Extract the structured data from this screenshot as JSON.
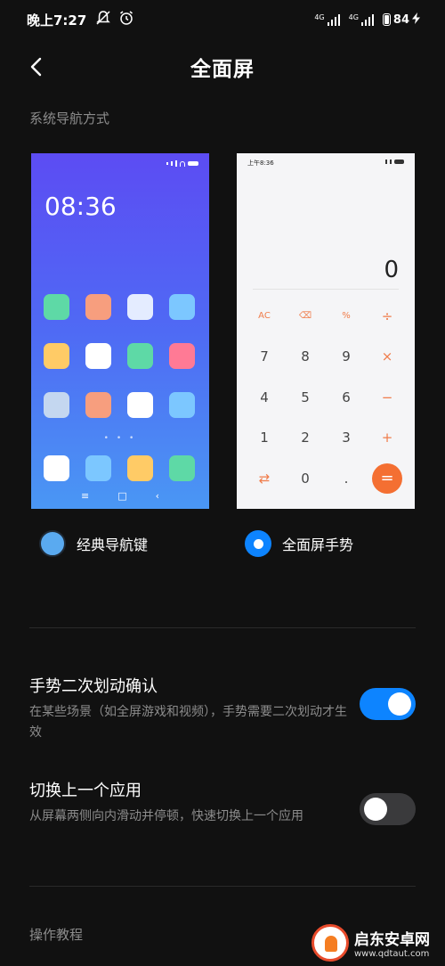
{
  "status_bar": {
    "time": "晚上7:27",
    "left_icons": [
      "notification-muted-icon",
      "alarm-icon"
    ],
    "network_1": "4G",
    "network_2": "4G",
    "battery": "84"
  },
  "header": {
    "title": "全面屏",
    "back_icon": "chevron-left-icon"
  },
  "nav_section": {
    "title": "系统导航方式"
  },
  "classic_preview": {
    "clock": "08:36",
    "app_colors": [
      "#5ed9a6",
      "#f79e7e",
      "#e4ecff",
      "#7cc7ff",
      "#ffcb66",
      "#ffffff",
      "#5ed9a6",
      "#ff7a95",
      "#c4d7f0",
      "#f79e7e",
      "#ffffff",
      "#7cc7ff"
    ],
    "dock_colors": [
      "#ffffff",
      "#7cc7ff",
      "#ffcb66",
      "#5ed9a6"
    ],
    "page_dots": "• • •",
    "nav_keys": [
      "≡",
      "□",
      "‹"
    ]
  },
  "gesture_preview": {
    "time": "上午8:36",
    "display": "0",
    "keys": [
      "AC",
      "⌫",
      "%",
      "÷",
      "7",
      "8",
      "9",
      "×",
      "4",
      "5",
      "6",
      "−",
      "1",
      "2",
      "3",
      "+",
      "⇄",
      "0",
      ".",
      "="
    ]
  },
  "options": [
    {
      "label": "经典导航键",
      "selected": false
    },
    {
      "label": "全面屏手势",
      "selected": true
    }
  ],
  "settings": [
    {
      "title": "手势二次划动确认",
      "desc": "在某些场景（如全屏游戏和视频），手势需要二次划动才生效",
      "enabled": true
    },
    {
      "title": "切换上一个应用",
      "desc": "从屏幕两侧向内滑动并停顿，快速切换上一个应用",
      "enabled": false
    }
  ],
  "tutorial": {
    "label": "操作教程"
  },
  "watermark": {
    "name": "启东安卓网",
    "url": "www.qdtaut.com"
  }
}
